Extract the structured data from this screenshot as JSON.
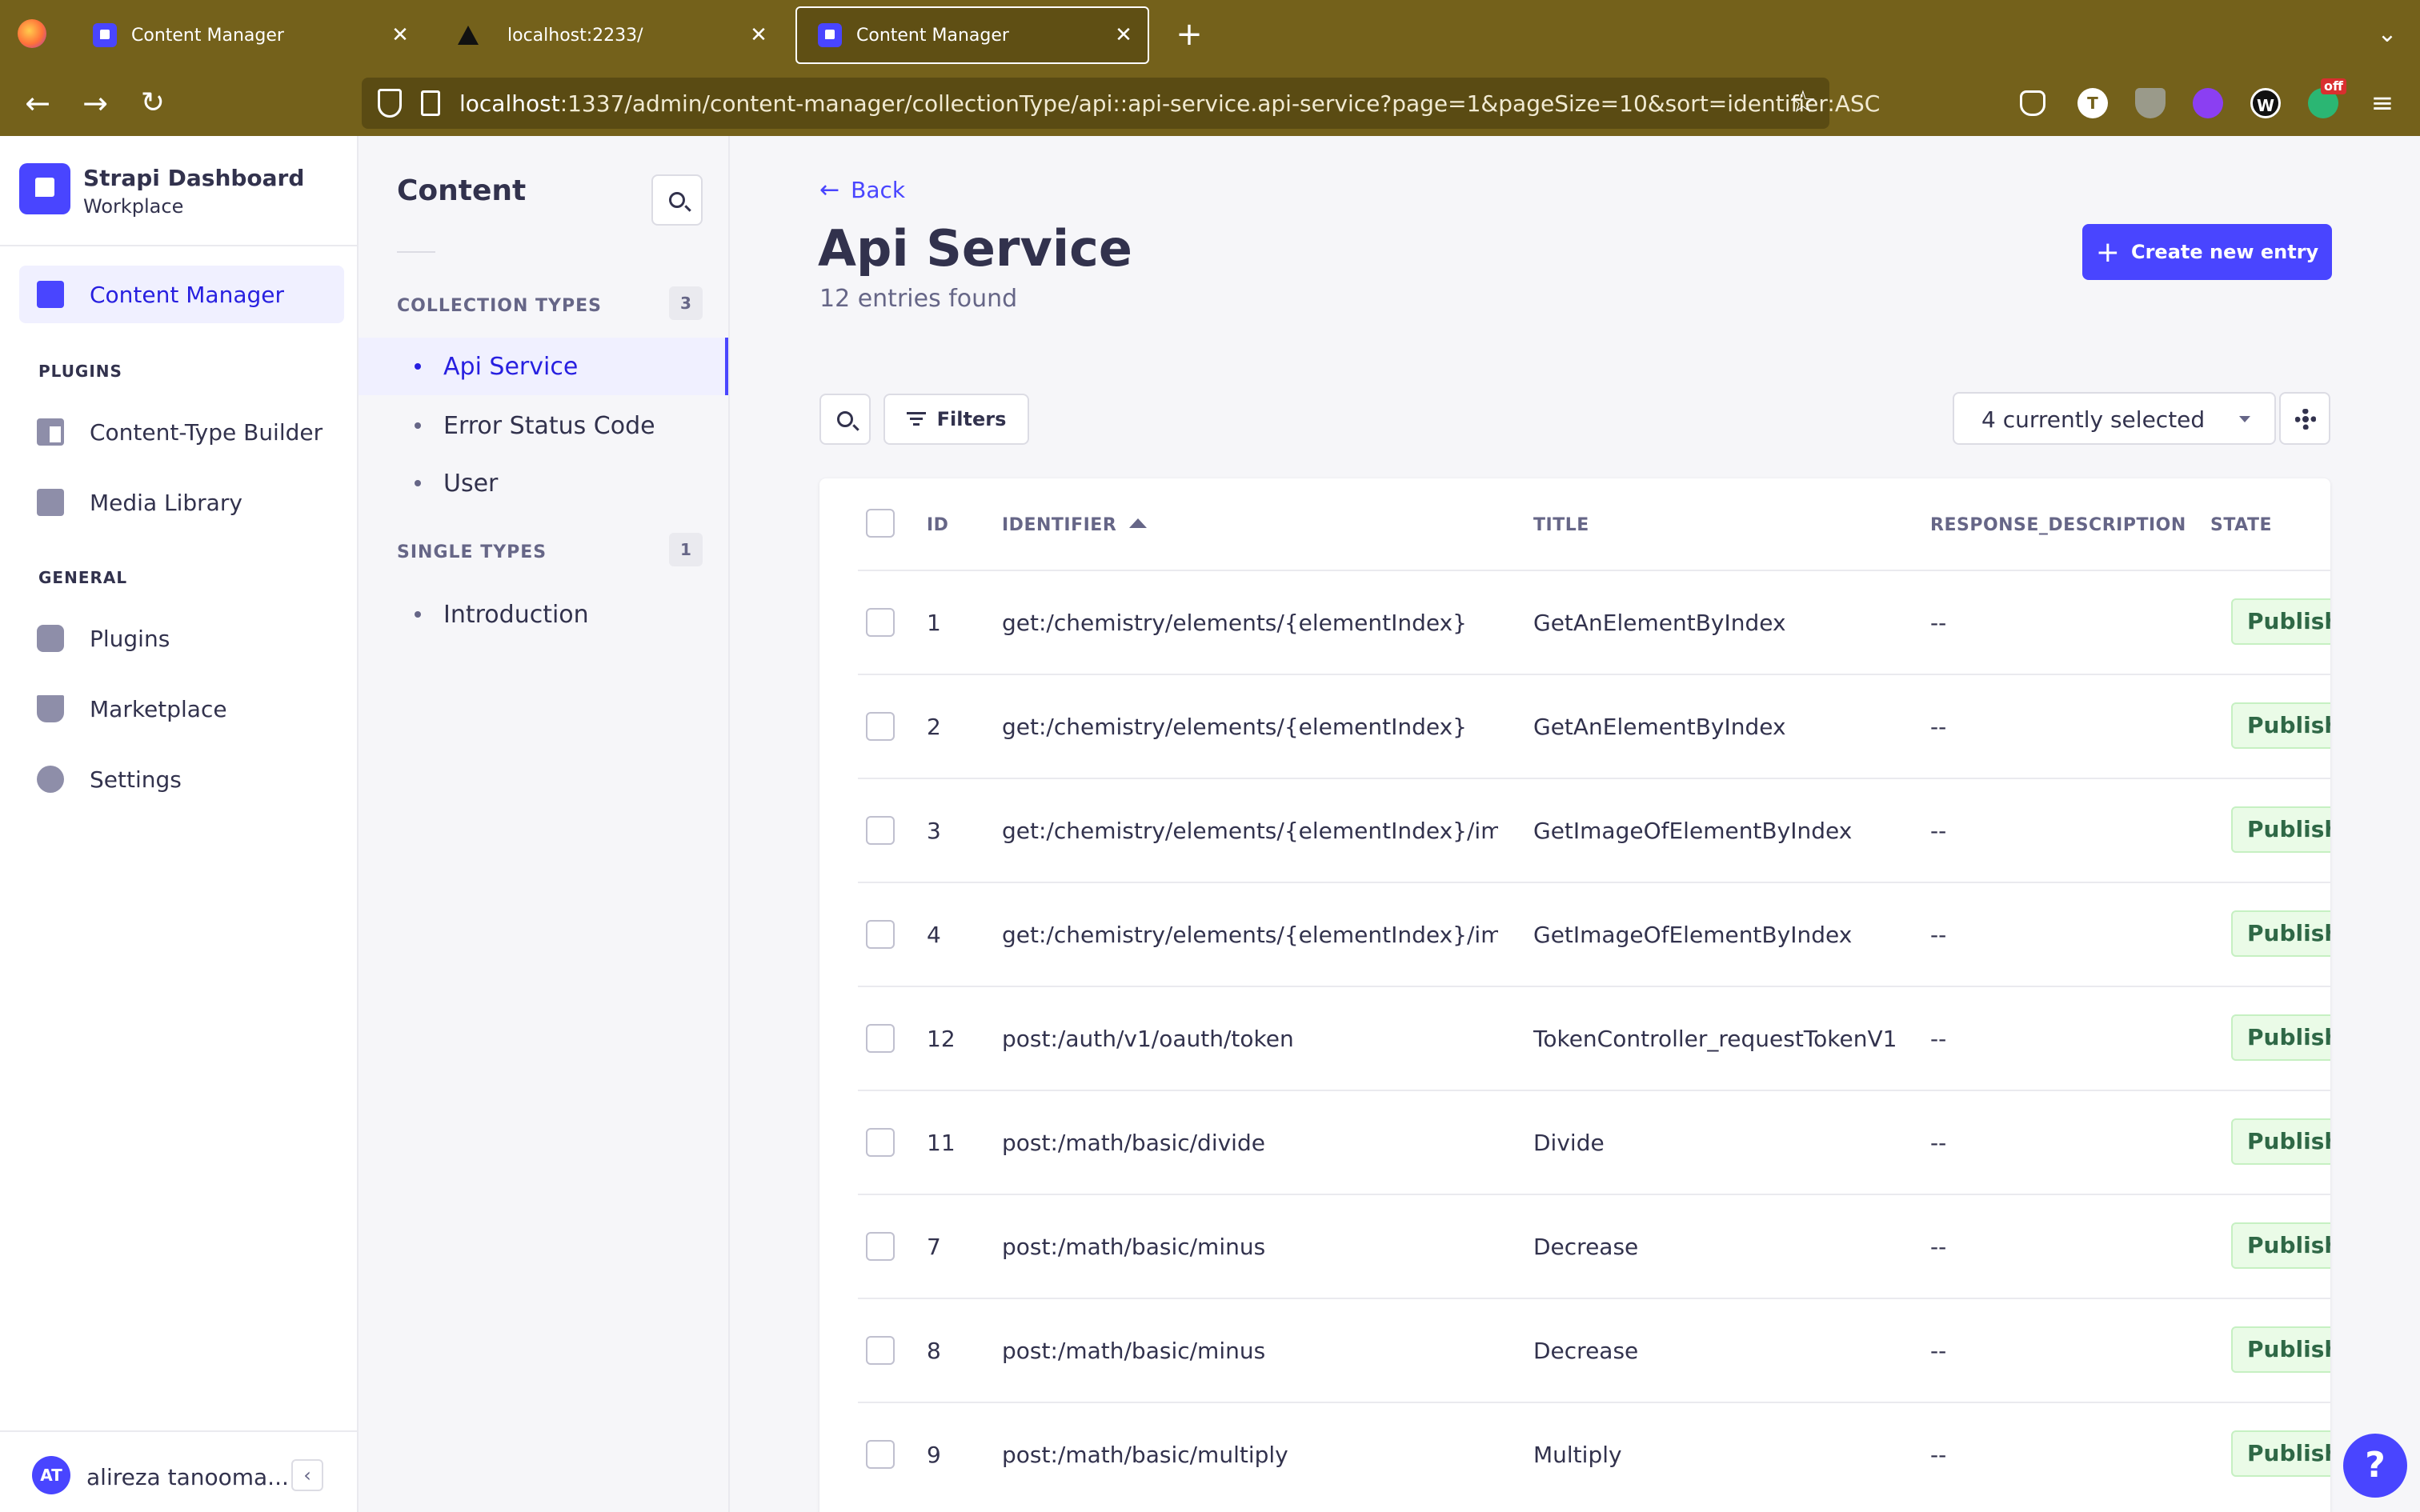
{
  "browser": {
    "tabs": [
      {
        "title": "Content Manager",
        "icon": "strapi-icon",
        "active": false
      },
      {
        "title": "localhost:2233/",
        "icon": "triangle-icon",
        "active": false
      },
      {
        "title": "Content Manager",
        "icon": "strapi-icon",
        "active": true
      }
    ],
    "url_host": "localhost",
    "url_rest": ":1337/admin/content-manager/collectionType/api::api-service.api-service?page=1&pageSize=10&sort=identifier:ASC",
    "extension_badge": "off"
  },
  "mainnav": {
    "brand_title": "Strapi Dashboard",
    "brand_subtitle": "Workplace",
    "content_manager": "Content Manager",
    "plugins_section": "PLUGINS",
    "content_type_builder": "Content-Type Builder",
    "media_library": "Media Library",
    "general_section": "GENERAL",
    "plugins": "Plugins",
    "marketplace": "Marketplace",
    "settings": "Settings",
    "user_initials": "AT",
    "user_name": "alireza tanooma..."
  },
  "subnav": {
    "title": "Content",
    "collection_types_label": "COLLECTION TYPES",
    "collection_types_count": "3",
    "collection_types": [
      "Api Service",
      "Error Status Code",
      "User"
    ],
    "single_types_label": "SINGLE TYPES",
    "single_types_count": "1",
    "single_types": [
      "Introduction"
    ]
  },
  "main": {
    "back_label": "Back",
    "title": "Api Service",
    "subtitle": "12 entries found",
    "create_label": "Create new entry",
    "filters_label": "Filters",
    "columns_selected": "4 currently selected",
    "headers": {
      "id": "ID",
      "identifier": "IDENTIFIER",
      "title": "TITLE",
      "response_description": "RESPONSE_DESCRIPTION",
      "state": "STATE"
    },
    "rows": [
      {
        "id": "1",
        "identifier": "get:/chemistry/elements/{elementIndex}",
        "title": "GetAnElementByIndex",
        "response_description": "--",
        "state": "Published"
      },
      {
        "id": "2",
        "identifier": "get:/chemistry/elements/{elementIndex}",
        "title": "GetAnElementByIndex",
        "response_description": "--",
        "state": "Published"
      },
      {
        "id": "3",
        "identifier": "get:/chemistry/elements/{elementIndex}/im...",
        "title": "GetImageOfElementByIndex",
        "response_description": "--",
        "state": "Published"
      },
      {
        "id": "4",
        "identifier": "get:/chemistry/elements/{elementIndex}/im...",
        "title": "GetImageOfElementByIndex",
        "response_description": "--",
        "state": "Published"
      },
      {
        "id": "12",
        "identifier": "post:/auth/v1/oauth/token",
        "title": "TokenController_requestTokenV1",
        "response_description": "--",
        "state": "Published"
      },
      {
        "id": "11",
        "identifier": "post:/math/basic/divide",
        "title": "Divide",
        "response_description": "--",
        "state": "Published"
      },
      {
        "id": "7",
        "identifier": "post:/math/basic/minus",
        "title": "Decrease",
        "response_description": "--",
        "state": "Published"
      },
      {
        "id": "8",
        "identifier": "post:/math/basic/minus",
        "title": "Decrease",
        "response_description": "--",
        "state": "Published"
      },
      {
        "id": "9",
        "identifier": "post:/math/basic/multiply",
        "title": "Multiply",
        "response_description": "--",
        "state": "Published"
      }
    ]
  },
  "help_label": "?",
  "colors": {
    "brand": "#4945ff",
    "chrome": "#74611b",
    "published_bg": "#eafbe7",
    "published_text": "#2f6846"
  }
}
